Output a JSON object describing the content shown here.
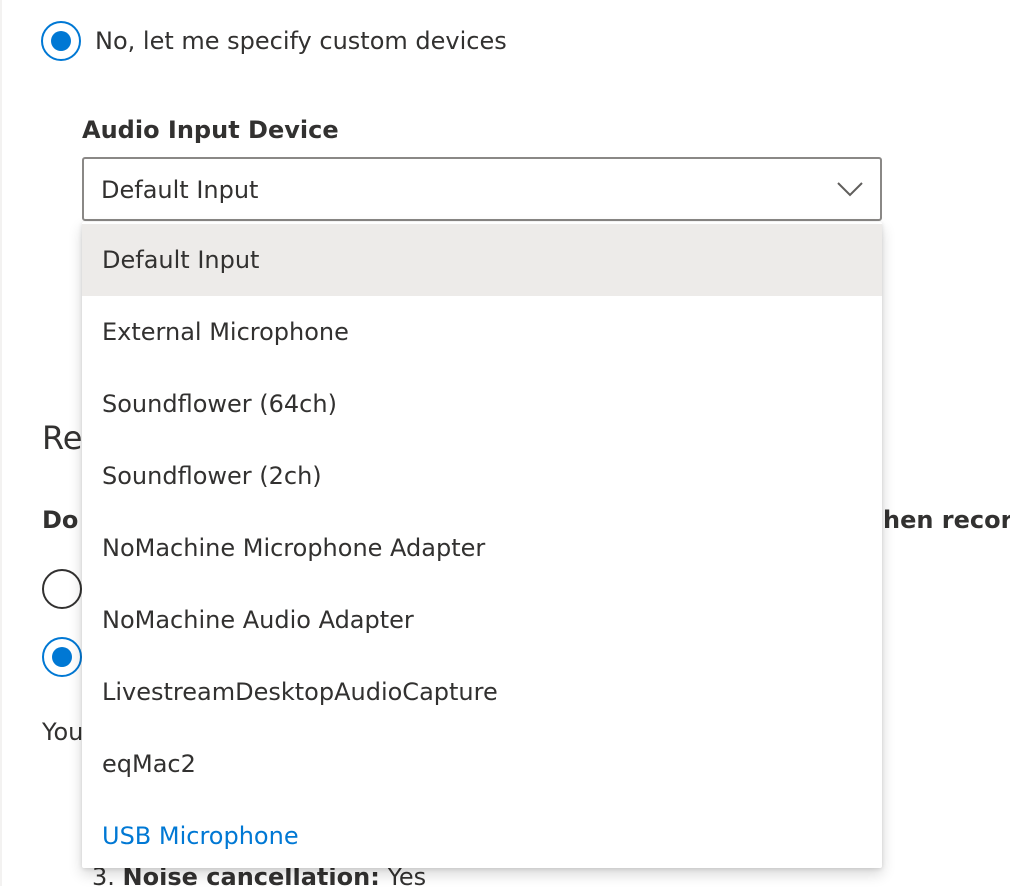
{
  "device_choice": {
    "custom_label": "No, let me specify custom devices",
    "custom_checked": true
  },
  "audio_input": {
    "label": "Audio Input Device",
    "selected_value": "Default Input",
    "options": [
      "Default Input",
      "External Microphone",
      "Soundflower (64ch)",
      "Soundflower (2ch)",
      "NoMachine Microphone Adapter",
      "NoMachine Audio Adapter",
      "LivestreamDesktopAudioCapture",
      "eqMac2",
      "USB Microphone"
    ],
    "selected_index": 0,
    "hovered_index": 8
  },
  "background": {
    "section_heading_fragment": "Re",
    "question_fragment_left": "Do",
    "question_fragment_right": "hen record",
    "info_fragment": "You",
    "list_item_number": "3.",
    "list_item_key": "Noise cancellation:",
    "list_item_value": "Yes"
  },
  "colors": {
    "accent": "#0078d4",
    "text": "#323130",
    "border": "#8a8886",
    "selected_bg": "#edebe9"
  },
  "icons": {
    "dropdown_caret": "chevron-down-icon"
  }
}
